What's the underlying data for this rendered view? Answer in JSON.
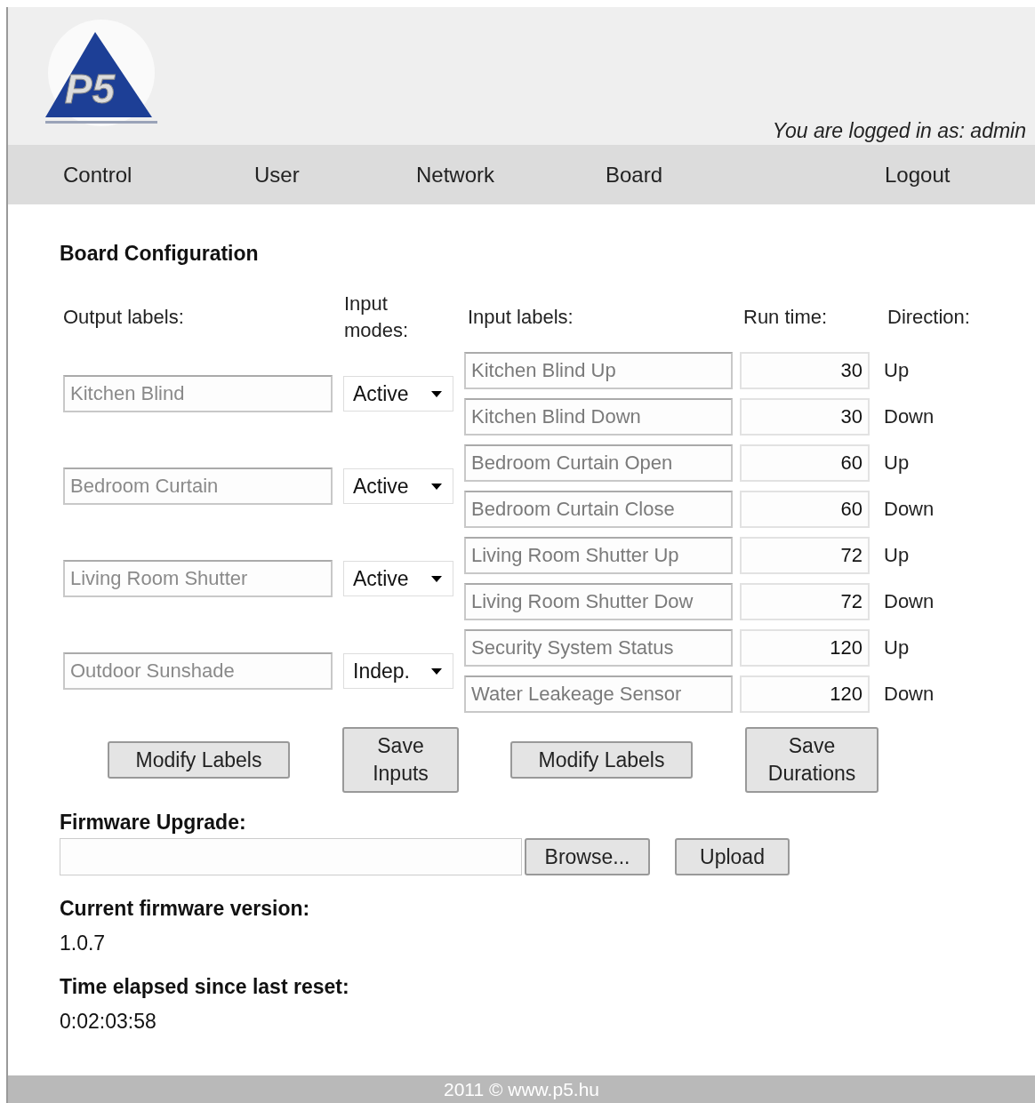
{
  "header": {
    "logo_text": "P5",
    "login_status": "You are logged in as: admin"
  },
  "nav": [
    {
      "label": "Control"
    },
    {
      "label": "User"
    },
    {
      "label": "Network"
    },
    {
      "label": "Board"
    },
    {
      "label": "Logout"
    }
  ],
  "title": "Board Configuration",
  "columns": {
    "output_labels": "Output labels:",
    "input_modes": "Input modes:",
    "input_labels": "Input labels:",
    "run_time": "Run time:",
    "direction": "Direction:"
  },
  "outputs": [
    {
      "label": "Kitchen Blind",
      "mode": "Active",
      "inputs": [
        {
          "label": "Kitchen Blind Up",
          "run_time": "30",
          "direction": "Up"
        },
        {
          "label": "Kitchen Blind Down",
          "run_time": "30",
          "direction": "Down"
        }
      ]
    },
    {
      "label": "Bedroom Curtain",
      "mode": "Active",
      "inputs": [
        {
          "label": "Bedroom Curtain Open",
          "run_time": "60",
          "direction": "Up"
        },
        {
          "label": "Bedroom Curtain Close",
          "run_time": "60",
          "direction": "Down"
        }
      ]
    },
    {
      "label": "Living Room Shutter",
      "mode": "Active",
      "inputs": [
        {
          "label": "Living Room Shutter Up",
          "run_time": "72",
          "direction": "Up"
        },
        {
          "label": "Living Room Shutter Dow",
          "run_time": "72",
          "direction": "Down"
        }
      ]
    },
    {
      "label": "Outdoor Sunshade",
      "mode": "Indep.",
      "inputs": [
        {
          "label": "Security System Status",
          "run_time": "120",
          "direction": "Up"
        },
        {
          "label": "Water Leakeage Sensor",
          "run_time": "120",
          "direction": "Down"
        }
      ]
    }
  ],
  "buttons": [
    "Modify Labels",
    "Save Inputs",
    "Modify Labels",
    "Save Durations"
  ],
  "firmware": {
    "label": "Firmware Upgrade:",
    "browse": "Browse...",
    "upload": "Upload",
    "version_label": "Current firmware version:",
    "version": "1.0.7",
    "uptime_label": "Time elapsed since last reset:",
    "uptime": "0:02:03:58"
  },
  "footer": "2011 © www.p5.hu"
}
